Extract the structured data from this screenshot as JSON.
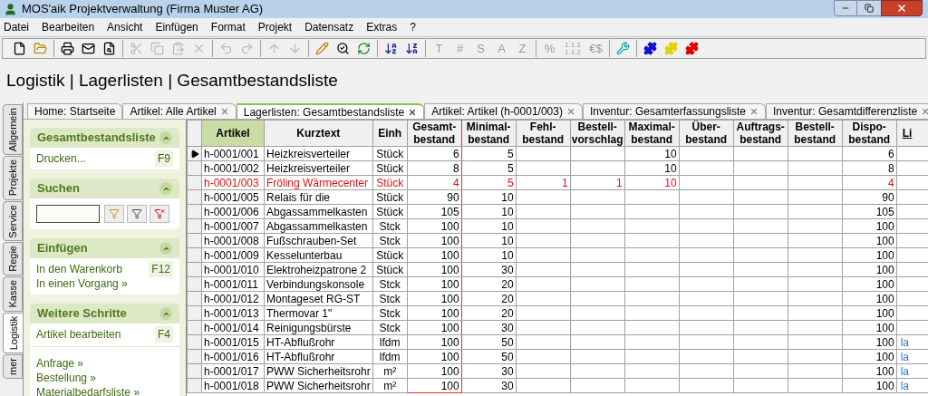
{
  "window": {
    "title": "MOS'aik Projektverwaltung (Firma Muster AG)"
  },
  "menu": [
    "Datei",
    "Bearbeiten",
    "Ansicht",
    "Einfügen",
    "Format",
    "Projekt",
    "Datensatz",
    "Extras",
    "?"
  ],
  "toolbar": [
    [
      {
        "disabled": false
      },
      {
        "disabled": false
      }
    ],
    [
      {
        "disabled": false
      },
      {
        "disabled": false
      },
      {
        "disabled": false
      }
    ],
    [
      {
        "disabled": true
      },
      {
        "disabled": true
      },
      {
        "disabled": true
      },
      {
        "disabled": true
      }
    ],
    [
      {
        "disabled": true
      },
      {
        "disabled": true
      }
    ],
    [
      {
        "disabled": true
      },
      {
        "disabled": true
      }
    ],
    [
      {
        "disabled": false
      },
      {
        "disabled": false
      },
      {
        "disabled": false
      }
    ],
    [
      {
        "disabled": false
      },
      {
        "disabled": false
      }
    ],
    [
      {
        "glyph": "T",
        "disabled": true
      },
      {
        "glyph": "#",
        "disabled": true
      },
      {
        "glyph": "S",
        "disabled": true
      },
      {
        "glyph": "A",
        "disabled": true
      },
      {
        "glyph": "Z",
        "disabled": true
      }
    ],
    [
      {
        "glyph": "%",
        "disabled": true
      },
      {
        "glyph": "1.1.1\n1.1.2",
        "disabled": true
      },
      {
        "glyph": "€$",
        "disabled": true
      }
    ],
    [
      {
        "disabled": false
      }
    ],
    [
      {
        "disabled": false
      },
      {
        "disabled": false
      },
      {
        "disabled": false
      }
    ]
  ],
  "breadcrumb": "Logistik | Lagerlisten | Gesamtbestandsliste",
  "side_tabs": [
    {
      "label": "Allgemein",
      "selected": false
    },
    {
      "label": "Projekte",
      "selected": false
    },
    {
      "label": "Service",
      "selected": false
    },
    {
      "label": "Regie",
      "selected": false
    },
    {
      "label": "Kasse",
      "selected": false
    },
    {
      "label": "Logistik",
      "selected": true
    },
    {
      "label": "mer",
      "selected": false
    }
  ],
  "tabs": [
    {
      "label": "Home: Startseite",
      "closable": false,
      "selected": false
    },
    {
      "label": "Artikel: Alle Artikel",
      "closable": true,
      "selected": false
    },
    {
      "label": "Lagerlisten: Gesamtbestandsliste",
      "closable": true,
      "selected": true
    },
    {
      "label": "Artikel: Artikel (h-0001/003)",
      "closable": true,
      "selected": false
    },
    {
      "label": "Inventur: Gesamterfassungsliste",
      "closable": true,
      "selected": false
    },
    {
      "label": "Inventur: Gesamtdifferenzliste",
      "closable": true,
      "selected": false
    }
  ],
  "panels": [
    {
      "title": "Gesamtbestandsliste",
      "expanded": true,
      "items": [
        {
          "label": "Drucken...",
          "shortcut": "F9"
        }
      ]
    },
    {
      "title": "Suchen",
      "expanded": true,
      "kind": "search"
    },
    {
      "title": "Einfügen",
      "expanded": true,
      "items": [
        {
          "label": "In den Warenkorb",
          "shortcut": "F12"
        },
        {
          "label": "In einen Vorgang »"
        }
      ]
    },
    {
      "title": "Weitere Schritte",
      "expanded": true,
      "items": [
        {
          "label": "Artikel bearbeiten",
          "shortcut": "F4"
        }
      ],
      "links": [
        "Anfrage »",
        "Bestellung »",
        "Materialbedarfsliste »"
      ]
    }
  ],
  "table": {
    "columns": [
      {
        "label": "Artikel",
        "sorted": true
      },
      {
        "label": "Kurztext",
        "sorted": false
      },
      {
        "label": "Einh",
        "sorted": false
      },
      {
        "label": "Gesamt-\nbestand",
        "sorted": false
      },
      {
        "label": "Minimal-\nbestand",
        "sorted": false
      },
      {
        "label": "Fehl-\nbestand",
        "sorted": false
      },
      {
        "label": "Bestell-\nvorschlag",
        "sorted": false
      },
      {
        "label": "Maximal-\nbestand",
        "sorted": false
      },
      {
        "label": "Über-\nbestand",
        "sorted": false
      },
      {
        "label": "Auftrags-\nbestand",
        "sorted": false
      },
      {
        "label": "Bestell-\nbestand",
        "sorted": false
      },
      {
        "label": "Dispo-\nbestand",
        "sorted": false
      },
      {
        "label": "Li",
        "sorted": false
      }
    ],
    "rows": [
      {
        "current": true,
        "alert": false,
        "artikel": "h-0001/001",
        "kurztext": "Heizkreisverteiler",
        "einh": "Stück",
        "gesamt": "6",
        "minimal": "5",
        "maximal": "10",
        "dispo": "6"
      },
      {
        "current": false,
        "alert": false,
        "artikel": "h-0001/002",
        "kurztext": "Heizkreisverteiler",
        "einh": "Stück",
        "gesamt": "8",
        "minimal": "5",
        "maximal": "10",
        "dispo": "8"
      },
      {
        "current": false,
        "alert": true,
        "artikel": "h-0001/003",
        "kurztext": "Fröling Wärmecenter",
        "einh": "Stück",
        "gesamt": "4",
        "minimal": "5",
        "fehl": "1",
        "vorschlag": "1",
        "maximal": "10",
        "dispo": "4"
      },
      {
        "current": false,
        "alert": false,
        "artikel": "h-0001/005",
        "kurztext": "Relais für die",
        "einh": "Stück",
        "gesamt": "90",
        "minimal": "10",
        "dispo": "90"
      },
      {
        "current": false,
        "alert": false,
        "artikel": "h-0001/006",
        "kurztext": "Abgassammelkasten",
        "einh": "Stück",
        "gesamt": "105",
        "minimal": "10",
        "dispo": "105"
      },
      {
        "current": false,
        "alert": false,
        "artikel": "h-0001/007",
        "kurztext": "Abgassammelkasten",
        "einh": "Stck",
        "gesamt": "100",
        "minimal": "10",
        "dispo": "100"
      },
      {
        "current": false,
        "alert": false,
        "artikel": "h-0001/008",
        "kurztext": "Fußschrauben-Set",
        "einh": "Stck",
        "gesamt": "100",
        "minimal": "10",
        "dispo": "100"
      },
      {
        "current": false,
        "alert": false,
        "artikel": "h-0001/009",
        "kurztext": "Kesselunterbau",
        "einh": "Stück",
        "gesamt": "100",
        "minimal": "10",
        "dispo": "100"
      },
      {
        "current": false,
        "alert": false,
        "artikel": "h-0001/010",
        "kurztext": "Elektroheizpatrone 2",
        "einh": "Stück",
        "gesamt": "100",
        "minimal": "30",
        "dispo": "100"
      },
      {
        "current": false,
        "alert": false,
        "artikel": "h-0001/011",
        "kurztext": "Verbindungskonsole",
        "einh": "Stck",
        "gesamt": "100",
        "minimal": "20",
        "dispo": "100"
      },
      {
        "current": false,
        "alert": false,
        "artikel": "h-0001/012",
        "kurztext": "Montageset RG-ST",
        "einh": "Stck",
        "gesamt": "100",
        "minimal": "20",
        "dispo": "100"
      },
      {
        "current": false,
        "alert": false,
        "artikel": "h-0001/013",
        "kurztext": "Thermovar 1\"",
        "einh": "Stck",
        "gesamt": "100",
        "minimal": "20",
        "dispo": "100"
      },
      {
        "current": false,
        "alert": false,
        "artikel": "h-0001/014",
        "kurztext": "Reinigungsbürste",
        "einh": "Stck",
        "gesamt": "100",
        "minimal": "30",
        "dispo": "100"
      },
      {
        "current": false,
        "alert": false,
        "artikel": "h-0001/015",
        "kurztext": "HT-Abflußrohr",
        "einh": "lfdm",
        "gesamt": "100",
        "minimal": "50",
        "dispo": "100",
        "column_13": "la"
      },
      {
        "current": false,
        "alert": false,
        "artikel": "h-0001/016",
        "kurztext": "HT-Abflußrohr",
        "einh": "lfdm",
        "gesamt": "100",
        "minimal": "50",
        "dispo": "100",
        "column_13": "la"
      },
      {
        "current": false,
        "alert": false,
        "artikel": "h-0001/017",
        "kurztext": "PWW Sicherheitsrohr",
        "einh": "m²",
        "gesamt": "100",
        "minimal": "30",
        "dispo": "100",
        "column_13": "la"
      },
      {
        "current": false,
        "alert": false,
        "artikel": "h-0001/018",
        "kurztext": "PWW Sicherheitsrohr",
        "einh": "m²",
        "gesamt": "100",
        "minimal": "30",
        "dispo": "100",
        "column_13": "la"
      }
    ]
  }
}
